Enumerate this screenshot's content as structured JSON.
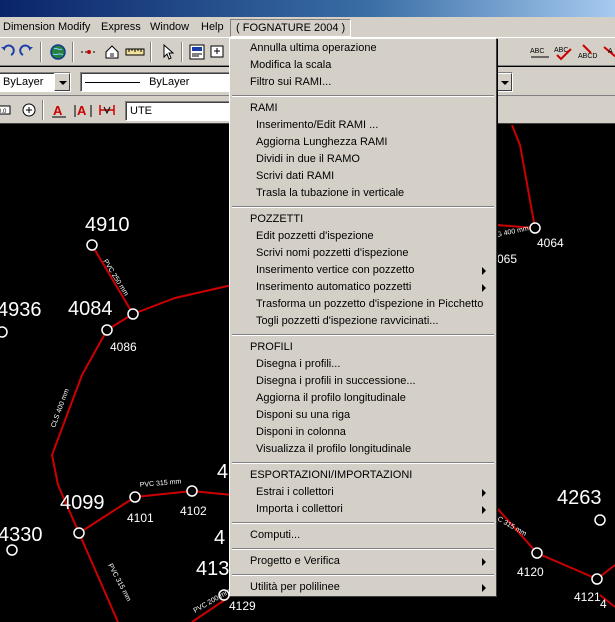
{
  "menubar": {
    "items": [
      {
        "label": "Dimension"
      },
      {
        "label": "Modify"
      },
      {
        "label": "Express"
      },
      {
        "label": "Window"
      },
      {
        "label": "Help"
      },
      {
        "label": "( FOGNATURE 2004 )"
      }
    ]
  },
  "toolbar": {
    "layer_combo": "ByLayer",
    "linetype_combo": "ByLayer",
    "style_combo": "UTE",
    "icons": [
      "undo-icon",
      "redo-icon",
      "globe-icon",
      "point-icon",
      "house-icon",
      "ruler-icon",
      "cursor-icon",
      "view-icon",
      "zoom-window-icon",
      "abc-text-icon",
      "spell-icon",
      "text-style-icon",
      "text-icon",
      "text-align-icon",
      "text-replace-icon",
      "dim-icon"
    ]
  },
  "menu": {
    "title": "FOGNATURE 2004",
    "top_items": [
      {
        "label": "Annulla ultima operazione"
      },
      {
        "label": "Modifica la scala"
      },
      {
        "label": "Filtro sui RAMI..."
      }
    ],
    "sections": [
      {
        "header": "RAMI",
        "items": [
          {
            "label": "Inserimento/Edit RAMI ...",
            "submenu": false
          },
          {
            "label": "Aggiorna Lunghezza RAMI",
            "submenu": false
          },
          {
            "label": "Dividi in due il RAMO",
            "submenu": false
          },
          {
            "label": "Scrivi dati RAMI",
            "submenu": false
          },
          {
            "label": "Trasla la tubazione in verticale",
            "submenu": false
          }
        ]
      },
      {
        "header": "POZZETTI",
        "items": [
          {
            "label": "Edit pozzetti d'ispezione",
            "submenu": false
          },
          {
            "label": "Scrivi nomi pozzetti d'ispezione",
            "submenu": false
          },
          {
            "label": "Inserimento vertice con pozzetto",
            "submenu": true
          },
          {
            "label": "Inserimento automatico pozzetti",
            "submenu": true
          },
          {
            "label": "Trasforma un pozzetto d'ispezione in Picchetto",
            "submenu": false
          },
          {
            "label": "Togli pozzetti d'ispezione ravvicinati...",
            "submenu": false
          }
        ]
      },
      {
        "header": "PROFILI",
        "items": [
          {
            "label": "Disegna i profili...",
            "submenu": false
          },
          {
            "label": "Disegna i profili in successione...",
            "submenu": false
          },
          {
            "label": "Aggiorna il profilo longitudinale",
            "submenu": false
          },
          {
            "label": "Disponi su una riga",
            "submenu": false
          },
          {
            "label": "Disponi in colonna",
            "submenu": false
          },
          {
            "label": "Visualizza il profilo longitudinale",
            "submenu": false
          }
        ]
      },
      {
        "header": "ESPORTAZIONI/IMPORTAZIONI",
        "items": [
          {
            "label": "Estrai i collettori",
            "submenu": true
          },
          {
            "label": "Importa i collettori",
            "submenu": true
          }
        ]
      }
    ],
    "bottom_items": [
      {
        "label": "Computi...",
        "submenu": false
      },
      {
        "label": "Progetto e Verifica",
        "submenu": true
      },
      {
        "label": "Utilità per polilinee",
        "submenu": true
      }
    ]
  },
  "drawing": {
    "colors": {
      "background": "#000000",
      "pipe": "#cc0000",
      "text": "#ffffff"
    },
    "labels_large": [
      "4910",
      "4936",
      "4084",
      "4099",
      "4330",
      "4263",
      "4",
      "4",
      "413"
    ],
    "labels_small": [
      "4064",
      "065",
      "4086",
      "4101",
      "4102",
      "4120",
      "4121",
      "4129",
      "4"
    ],
    "pipe_labels": [
      "PVC 250 mm",
      "CLS 400 mm",
      "PVC 315 mm",
      "PVC 315 mm",
      "PVC 200 mm",
      "G 400 mm",
      "C 315 mm"
    ]
  }
}
